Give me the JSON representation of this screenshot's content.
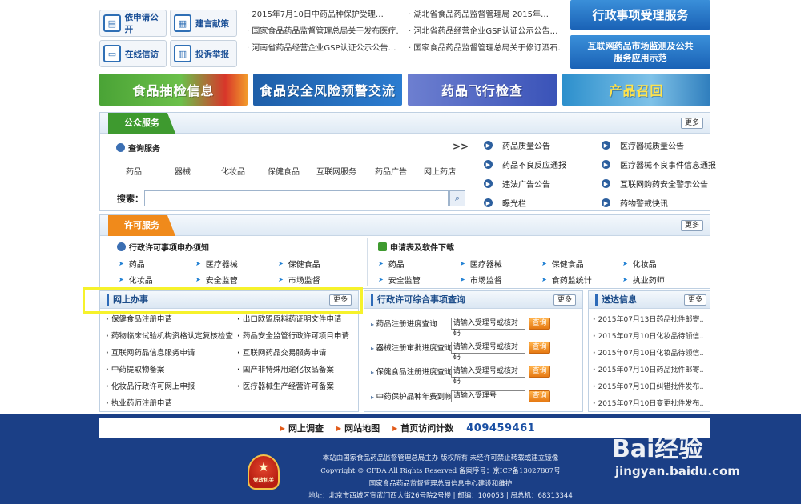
{
  "top_buttons": [
    {
      "label": "依申请公开",
      "icon": "file-icon"
    },
    {
      "label": "建言献策",
      "icon": "document-icon"
    },
    {
      "label": "在线信访",
      "icon": "monitor-icon"
    },
    {
      "label": "投诉举报",
      "icon": "report-icon"
    }
  ],
  "news_left": [
    "2015年7月10日中药品种保护受理…",
    "国家食品药品监督管理总局关于发布医疗…",
    "河南省药品经营企业GSP认证公示公告…"
  ],
  "news_right": [
    "湖北省食品药品监督管理局 2015年…",
    "河北省药品经营企业GSP认证公示公告…",
    "国家食品药品监督管理总局关于修订酒石…"
  ],
  "right_banners": {
    "admin": "行政事项受理服务",
    "internet_l1": "互联网药品市场监测及公共",
    "internet_l2": "服务应用示范"
  },
  "feature_banners": [
    "食品抽检信息",
    "食品安全风险预警交流",
    "药品飞行检查",
    "产品召回"
  ],
  "more_label": "更多",
  "public_service": {
    "title": "公众服务",
    "query_title": "查询服务",
    "chevron": ">>",
    "categories": [
      "药品",
      "器械",
      "化妆品",
      "保健食品",
      "互联网服务",
      "药品广告",
      "网上药店"
    ],
    "search_label": "搜索：",
    "links_left": [
      "药品质量公告",
      "药品不良反应通报",
      "违法广告公告",
      "曝光栏"
    ],
    "links_right": [
      "医疗器械质量公告",
      "医疗器械不良事件信息通报",
      "互联网购药安全警示公告",
      "药物警戒快讯"
    ]
  },
  "permit_service": {
    "title": "许可服务",
    "left_title": "行政许可事项申办须知",
    "left_items": [
      "药品",
      "医疗器械",
      "保健食品",
      "化妆品",
      "安全监管",
      "市场监督"
    ],
    "right_title": "申请表及软件下载",
    "right_items": [
      "药品",
      "医疗器械",
      "保健食品",
      "化妆品",
      "安全监管",
      "市场监督",
      "食药监统计",
      "执业药师"
    ]
  },
  "online": {
    "title": "网上办事",
    "items": [
      "保健食品注册申请",
      "出口欧盟原料药证明文件申请",
      "药物临床试验机构资格认定复核检查",
      "药品安全监管行政许可项目申请",
      "互联网药品信息服务申请",
      "互联网药品交易服务申请",
      "中药提取物备案",
      "国产非特殊用途化妆品备案",
      "化妆品行政许可网上申报",
      "医疗器械生产经营许可备案",
      "执业药师注册申请"
    ]
  },
  "query": {
    "title": "行政许可综合事项查询",
    "rows": [
      {
        "label": "药品注册进度查询",
        "placeholder": "请输入受理号或核对码",
        "btn": "查询"
      },
      {
        "label": "器械注册审批进度查询",
        "placeholder": "请输入受理号或核对码",
        "btn": "查询"
      },
      {
        "label": "保健食品注册进度查询",
        "placeholder": "请输入受理号或核对码",
        "btn": "查询"
      },
      {
        "label": "中药保护品种年费到帐查询",
        "placeholder": "请输入受理号",
        "btn": "查询"
      }
    ]
  },
  "deliver": {
    "title": "送达信息",
    "items": [
      "2015年07月13日药品批件邮寄…",
      "2015年07月10日化妆品待领信…",
      "2015年07月10日化妆品待领信…",
      "2015年07月10日药品批件邮寄…",
      "2015年07月10日纠错批件发布…",
      "2015年07月10日变更批件发布…"
    ]
  },
  "footer": {
    "links": [
      "网上调查",
      "网站地图",
      "首页访问计数"
    ],
    "counter": "409459461",
    "line1": "本站由国家食品药品监督管理总局主办 版权所有 未经许可禁止转载或建立镜像",
    "line2": "Copyright © CFDA All Rights Reserved    备案序号：京ICP备13027807号",
    "line3": "国家食品药品监督管理总局信息中心建设和维护",
    "line4": "地址：北京市西城区宣武门西大街26号院2号楼 | 邮编：100053 | 局总机：68313344",
    "emblem_text": "党政机关"
  },
  "watermark": {
    "brand": "Bai经验",
    "url": "jingyan.baidu.com"
  },
  "colors": {
    "primary": "#1b3f86",
    "accent_green": "#3e9a2f",
    "accent_orange": "#f08a1b",
    "highlight": "#f6f22b"
  }
}
